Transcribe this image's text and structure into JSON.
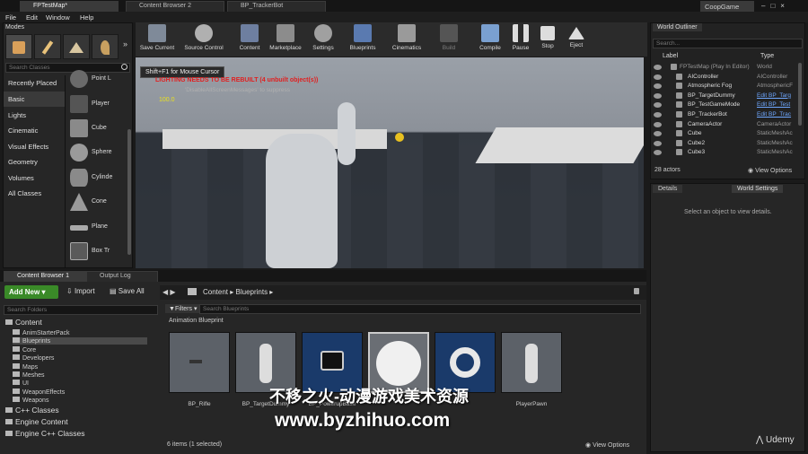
{
  "title_bar": {
    "tabs": [
      "FPTestMap*",
      "Content Browser 2",
      "BP_TrackerBot"
    ],
    "project": "CoopGame"
  },
  "menu": [
    "File",
    "Edit",
    "Window",
    "Help"
  ],
  "modes": {
    "title": "Modes",
    "search_placeholder": "Search Classes",
    "categories": [
      "Recently Placed",
      "Basic",
      "Lights",
      "Cinematic",
      "Visual Effects",
      "Geometry",
      "Volumes",
      "All Classes"
    ],
    "selected_category": "Basic",
    "items": [
      "Point L",
      "Player",
      "Cube",
      "Sphere",
      "Cylinde",
      "Cone",
      "Plane",
      "Box Tr"
    ]
  },
  "toolbar": {
    "buttons": [
      "Save Current",
      "Source Control",
      "Content",
      "Marketplace",
      "Settings",
      "Blueprints",
      "Cinematics",
      "Build",
      "Compile",
      "Pause",
      "Stop",
      "Eject"
    ]
  },
  "viewport": {
    "tooltip": "Shift+F1 for Mouse Cursor",
    "warning": "LIGHTING NEEDS TO BE REBUILT (4 unbuilt object(s))",
    "suppress": "'DisableAllScreenMessages' to suppress",
    "score": "100.0"
  },
  "world_outliner": {
    "title": "World Outliner",
    "search_placeholder": "Search...",
    "col_label": "Label",
    "col_type": "Type",
    "rows": [
      {
        "label": "FPTestMap (Play In Editor)",
        "type": "World",
        "link": false
      },
      {
        "label": "AIController",
        "type": "AIController",
        "link": false
      },
      {
        "label": "Atmospheric Fog",
        "type": "AtmosphericF",
        "link": false
      },
      {
        "label": "BP_TargetDummy",
        "type": "Edit BP_Targ",
        "link": true
      },
      {
        "label": "BP_TestGameMode",
        "type": "Edit BP_Test",
        "link": true
      },
      {
        "label": "BP_TrackerBot",
        "type": "Edit BP_Trac",
        "link": true
      },
      {
        "label": "CameraActor",
        "type": "CameraActor",
        "link": false
      },
      {
        "label": "Cube",
        "type": "StaticMeshAc",
        "link": false
      },
      {
        "label": "Cube2",
        "type": "StaticMeshAc",
        "link": false
      },
      {
        "label": "Cube3",
        "type": "StaticMeshAc",
        "link": false
      }
    ],
    "actor_count": "28 actors",
    "view_options": "View Options"
  },
  "details": {
    "tab1": "Details",
    "tab2": "World Settings",
    "hint": "Select an object to view details."
  },
  "content_browser": {
    "tabs": [
      "Content Browser 1",
      "Output Log"
    ],
    "add_new": "Add New",
    "import": "Import",
    "save_all": "Save All",
    "breadcrumb": [
      "Content",
      "Blueprints"
    ],
    "search_folders": "Search Folders",
    "filters": "Filters",
    "search_assets": "Search Blueprints",
    "folders": [
      "Content",
      "AnimStarterPack",
      "Blueprints",
      "Core",
      "Developers",
      "Maps",
      "Meshes",
      "UI",
      "WeaponEffects",
      "Weapons",
      "C++ Classes",
      "Engine Content",
      "Engine C++ Classes"
    ],
    "section": "Animation Blueprint",
    "assets": [
      "BP_Rifle",
      "BP_TargetDummy",
      "BP_PowerupBase",
      "",
      "",
      "PlayerPawn"
    ],
    "status": "6 items (1 selected)",
    "view_options": "View Options"
  },
  "watermark": {
    "cn": "不移之火-动漫游戏美术资源",
    "url": "www.byzhihuo.com",
    "brand": "Udemy"
  }
}
